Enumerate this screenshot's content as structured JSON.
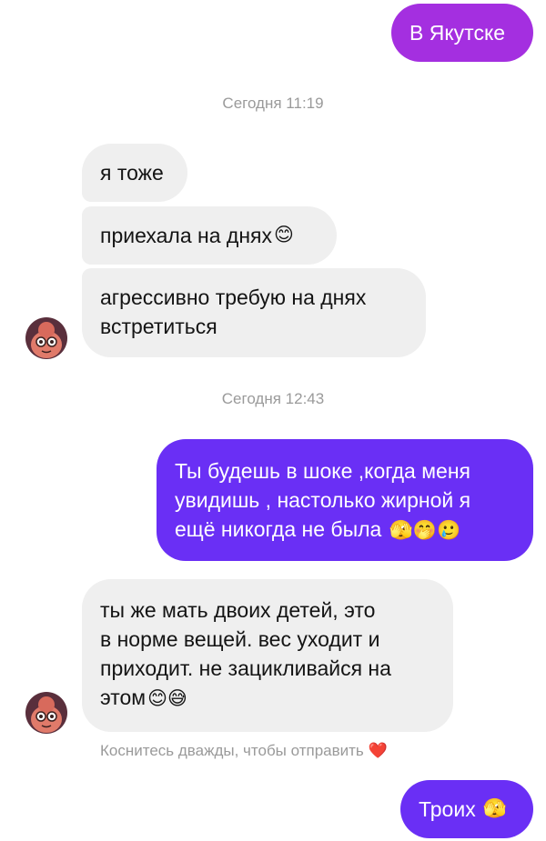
{
  "messages": [
    {
      "id": "m1",
      "direction": "outgoing",
      "text": "В Якутске"
    },
    {
      "id": "ts1",
      "type": "timestamp",
      "text": "Сегодня 11:19"
    },
    {
      "id": "m2",
      "direction": "incoming",
      "text": "я тоже"
    },
    {
      "id": "m3",
      "direction": "incoming",
      "text": "приехала на днях",
      "emoji": "😊"
    },
    {
      "id": "m4",
      "direction": "incoming",
      "lines": [
        "агрессивно требую на днях",
        "встретиться"
      ]
    },
    {
      "id": "ts2",
      "type": "timestamp",
      "text": "Сегодня 12:43"
    },
    {
      "id": "m5",
      "direction": "outgoing",
      "lines": [
        "Ты будешь в шоке ,когда меня",
        "увидишь , настолько жирной я",
        "ещё никогда не была"
      ],
      "emoji": "🫣🤭🥲"
    },
    {
      "id": "m6",
      "direction": "incoming",
      "lines": [
        "ты же мать двоих детей, это",
        "в норме вещей. вес уходит и",
        "приходит. не зацикливайся на",
        "этом"
      ],
      "emoji": "😊😅"
    },
    {
      "id": "m7",
      "direction": "outgoing",
      "text": "Троих",
      "emoji": "🫣"
    }
  ],
  "hint": {
    "text": "Коснитесь дважды, чтобы отправить",
    "emoji": "❤️"
  },
  "colors": {
    "outgoing_purple": "#a42fe0",
    "outgoing_violet": "#6a2ff5",
    "incoming_bg": "#efefef",
    "timestamp": "#9a9a9a"
  },
  "icons": {
    "avatar": "contact-avatar"
  }
}
